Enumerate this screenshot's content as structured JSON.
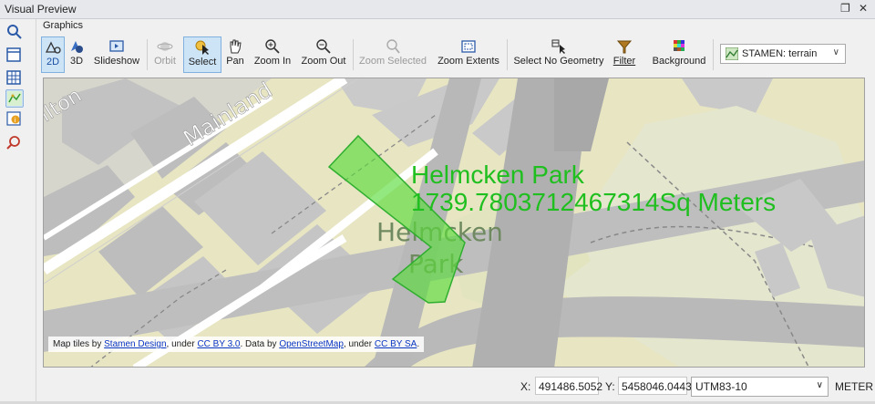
{
  "window": {
    "title": "Visual Preview"
  },
  "toolbar": {
    "group_label": "Graphics",
    "buttons": {
      "b2d": "2D",
      "b3d": "3D",
      "slideshow": "Slideshow",
      "orbit": "Orbit",
      "select": "Select",
      "pan": "Pan",
      "zoom_in": "Zoom In",
      "zoom_out": "Zoom Out",
      "zoom_selected": "Zoom Selected",
      "zoom_extents": "Zoom Extents",
      "select_no_geometry": "Select No Geometry",
      "filter": "Filter",
      "background": "Background"
    },
    "basemap": "STAMEN: terrain"
  },
  "map": {
    "feature_name": "Helmcken Park",
    "feature_area": "1739.7803712467314Sq Meters",
    "street_label": "Mainland",
    "street_label_2": "ilton",
    "park_label_1": "Helmcken",
    "park_label_2": "Park",
    "attribution": {
      "prefix": "Map tiles by ",
      "link1": "Stamen Design",
      "mid1": ", under ",
      "link2": "CC BY 3.0",
      "mid2": ". Data by ",
      "link3": "OpenStreetMap",
      "mid3": ", under ",
      "link4": "CC BY SA",
      "suffix": "."
    }
  },
  "status": {
    "x_label": "X:",
    "x_value": "491486.5052",
    "y_label": "Y:",
    "y_value": "5458046.0443",
    "coord_system": "UTM83-10",
    "units": "METER"
  },
  "colors": {
    "accent": "#2fbf2f",
    "selected_bg": "#cde4f7"
  }
}
